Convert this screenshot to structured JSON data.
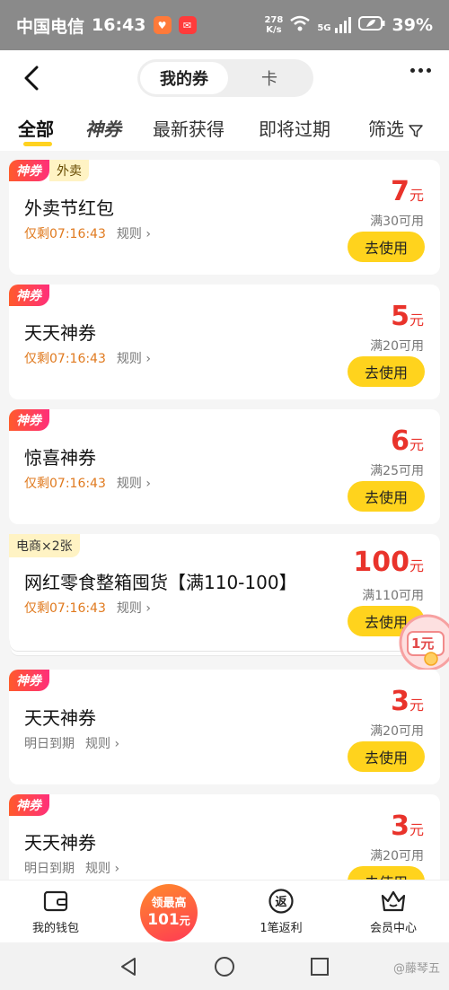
{
  "status_bar": {
    "carrier": "中国电信",
    "time": "16:43",
    "speed_value": "278",
    "speed_unit": "K/s",
    "network": "5G",
    "battery": "39%"
  },
  "header": {
    "segment_active": "我的券",
    "segment_other": "卡"
  },
  "tabs": {
    "all": "全部",
    "shen": "神券",
    "newest": "最新获得",
    "expiring": "即将过期",
    "filter": "筛选"
  },
  "coupons": [
    {
      "badge": "神券",
      "category": "外卖",
      "title": "外卖节红包",
      "time": "仅剩07:16:43",
      "rule": "规则",
      "amount": "7",
      "unit": "元",
      "condition": "满30可用",
      "action": "去使用"
    },
    {
      "badge": "神券",
      "title": "天天神券",
      "time": "仅剩07:16:43",
      "rule": "规则",
      "amount": "5",
      "unit": "元",
      "condition": "满20可用",
      "action": "去使用"
    },
    {
      "badge": "神券",
      "title": "惊喜神券",
      "time": "仅剩07:16:43",
      "rule": "规则",
      "amount": "6",
      "unit": "元",
      "condition": "满25可用",
      "action": "去使用"
    },
    {
      "pack": "电商×2张",
      "title": "网红零食整箱囤货【满110-100】",
      "time": "仅剩07:16:43",
      "rule": "规则",
      "amount": "100",
      "unit": "元",
      "condition": "满110可用",
      "action": "去使用"
    },
    {
      "badge": "神券",
      "title": "天天神券",
      "time": "明日到期",
      "rule": "规则",
      "amount": "3",
      "unit": "元",
      "condition": "满20可用",
      "action": "去使用"
    },
    {
      "badge": "神券",
      "title": "天天神券",
      "time": "明日到期",
      "rule": "规则",
      "amount": "3",
      "unit": "元",
      "condition": "满20可用",
      "action": "去使用"
    }
  ],
  "float_badge": "1元",
  "bottom_nav": {
    "wallet": "我的钱包",
    "promo_line1": "领最高",
    "promo_amount": "101",
    "promo_unit": "元",
    "rebate": "1笔返利",
    "member": "会员中心"
  },
  "watermark": "@藤琴五",
  "colors": {
    "accent_yellow": "#ffd31d",
    "price_red": "#e9332b",
    "countdown_orange": "#e07a1f"
  }
}
